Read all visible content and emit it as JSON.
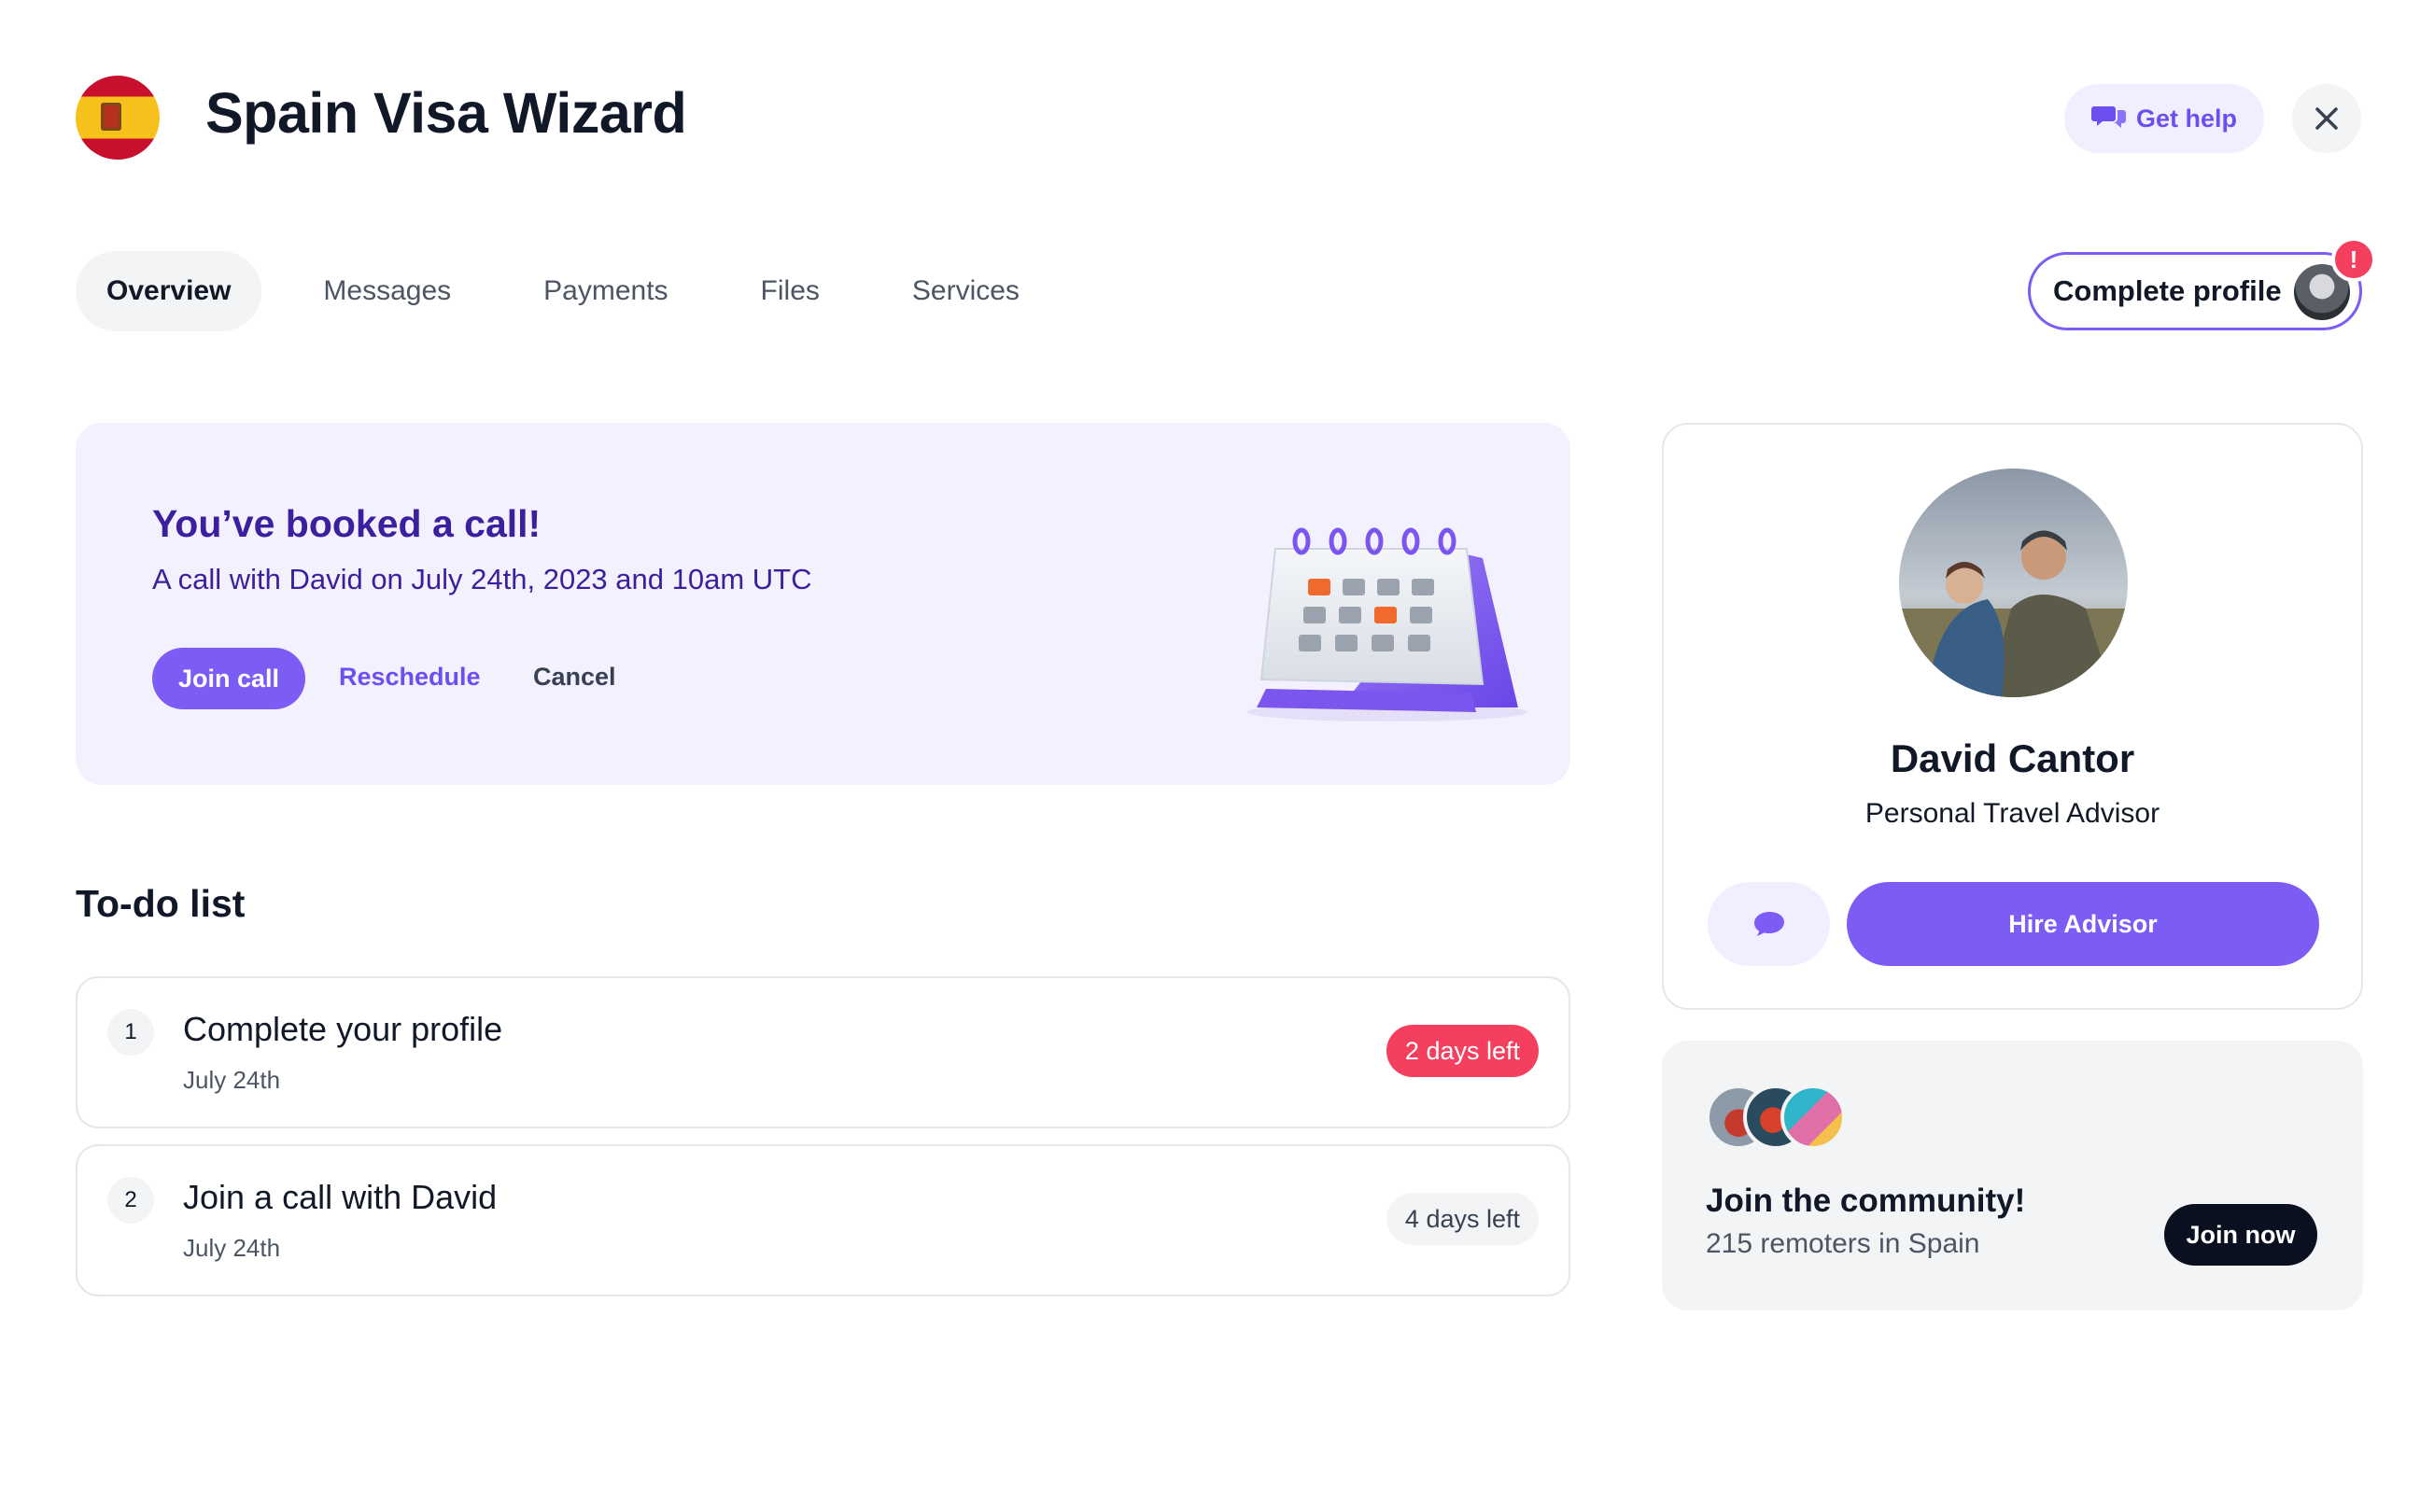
{
  "header": {
    "title": "Spain Visa Wizard",
    "flag_icon": "spain-flag-icon",
    "help_label": "Get help",
    "help_icon": "chat-bubbles-icon",
    "close_icon": "close-icon"
  },
  "tabs": [
    {
      "label": "Overview",
      "active": true
    },
    {
      "label": "Messages",
      "active": false
    },
    {
      "label": "Payments",
      "active": false
    },
    {
      "label": "Files",
      "active": false
    },
    {
      "label": "Services",
      "active": false
    }
  ],
  "profile_button": {
    "label": "Complete profile",
    "badge": "!"
  },
  "booked_call": {
    "title": "You’ve booked a call!",
    "description": "A call with David on July 24th, 2023 and 10am UTC",
    "join_label": "Join call",
    "reschedule_label": "Reschedule",
    "cancel_label": "Cancel",
    "illustration": "calendar-illustration"
  },
  "todo": {
    "heading": "To-do list",
    "items": [
      {
        "number": "1",
        "title": "Complete your profile",
        "date": "July 24th",
        "badge": "2 days left",
        "urgent": true
      },
      {
        "number": "2",
        "title": "Join a call with David",
        "date": "July 24th",
        "badge": "4 days left",
        "urgent": false
      }
    ]
  },
  "advisor": {
    "name": "David Cantor",
    "role": "Personal Travel Advisor",
    "chat_icon": "chat-bubble-icon",
    "hire_label": "Hire Advisor"
  },
  "community": {
    "title": "Join the community!",
    "subtitle": "215 remoters in Spain",
    "join_label": "Join now"
  },
  "colors": {
    "accent": "#7c5cf5",
    "accent_dark": "#3b1f9e",
    "urgent": "#f43f5e",
    "card_tint": "#f3f1fe"
  }
}
